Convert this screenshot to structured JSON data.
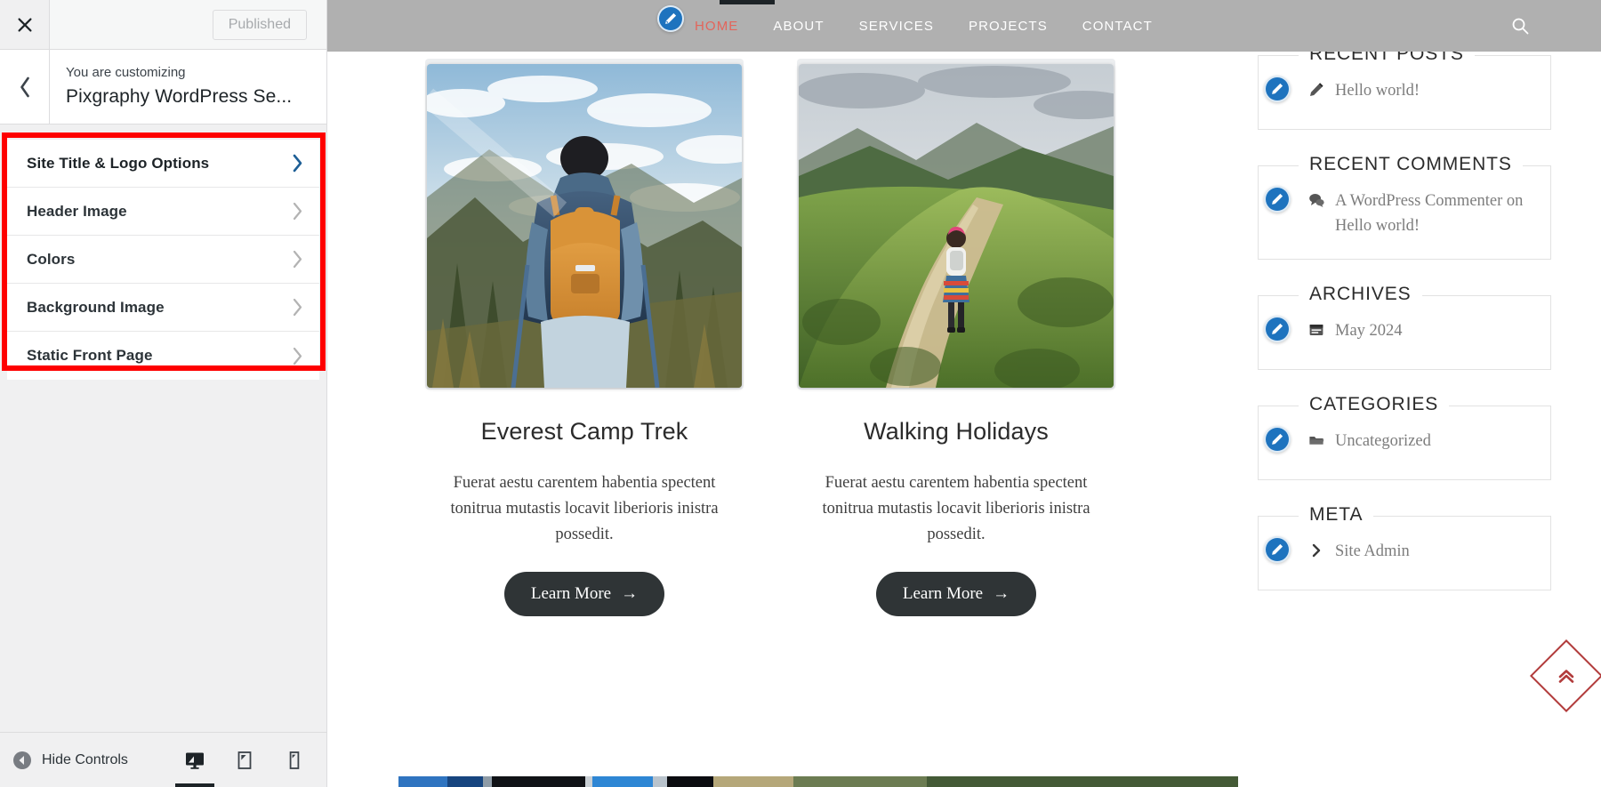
{
  "customizer": {
    "close_label": "Close customizer",
    "publish_label": "Published",
    "back_label": "Back",
    "eyebrow": "You are customizing",
    "site_name": "Pixgraphy WordPress Se...",
    "sections": [
      {
        "label": "Site Title & Logo Options"
      },
      {
        "label": "Header Image"
      },
      {
        "label": "Colors"
      },
      {
        "label": "Background Image"
      },
      {
        "label": "Static Front Page"
      }
    ],
    "highlight_color": "#fe0000",
    "footer": {
      "hide_controls_label": "Hide Controls",
      "devices": [
        {
          "name": "desktop",
          "label": "Enter desktop preview mode",
          "active": true
        },
        {
          "name": "tablet",
          "label": "Enter tablet preview mode",
          "active": false
        },
        {
          "name": "mobile",
          "label": "Enter mobile preview mode",
          "active": false
        }
      ]
    }
  },
  "preview": {
    "header": {
      "bg_color": "#b0b0b0",
      "active_link_color": "#e3655b",
      "nav": [
        {
          "label": "HOME",
          "current": true
        },
        {
          "label": "ABOUT",
          "current": false
        },
        {
          "label": "SERVICES",
          "current": false
        },
        {
          "label": "PROJECTS",
          "current": false
        },
        {
          "label": "CONTACT",
          "current": false
        }
      ],
      "search_label": "Search",
      "edit_menu_label": "Edit menu"
    },
    "cards": [
      {
        "title": "Everest Camp Trek",
        "text": "Fuerat aestu carentem habentia spectent tonitrua mutastis locavit liberioris inistra possedit.",
        "button_label": "Learn More",
        "button_arrow": "→",
        "image_alt": "Hiker with orange backpack facing snowy mountains"
      },
      {
        "title": "Walking Holidays",
        "text": "Fuerat aestu carentem habentia spectent tonitrua mutastis locavit liberioris inistra possedit.",
        "button_label": "Learn More",
        "button_arrow": "→",
        "image_alt": "Person walking a green mountain ridge trail"
      }
    ],
    "widgets": [
      {
        "title": "RECENT POSTS",
        "icon": "pencil-icon",
        "items": [
          {
            "text": "Hello world!"
          }
        ]
      },
      {
        "title": "RECENT COMMENTS",
        "icon": "comments-icon",
        "items": [
          {
            "text": "A WordPress Commenter on Hello world!"
          }
        ]
      },
      {
        "title": "ARCHIVES",
        "icon": "calendar-icon",
        "items": [
          {
            "text": "May 2024"
          }
        ]
      },
      {
        "title": "CATEGORIES",
        "icon": "folder-icon",
        "items": [
          {
            "text": "Uncategorized"
          }
        ]
      },
      {
        "title": "META",
        "icon": "chevron-right-icon",
        "items": [
          {
            "text": "Site Admin"
          }
        ]
      }
    ],
    "scroll_top_label": "Scroll to top",
    "scroll_top_color": "#b23c3c",
    "edit_badge_color": "#1e73be"
  }
}
